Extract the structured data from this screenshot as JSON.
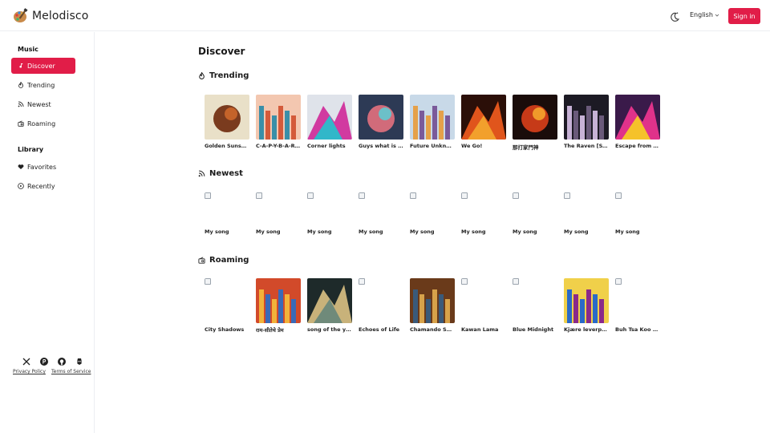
{
  "app": {
    "name": "Melodisco"
  },
  "header": {
    "language": "English",
    "sign_in": "Sign in"
  },
  "sidebar": {
    "music_label": "Music",
    "music_items": [
      {
        "label": "Discover",
        "icon": "music-note-icon",
        "active": true
      },
      {
        "label": "Trending",
        "icon": "flame-icon"
      },
      {
        "label": "Newest",
        "icon": "rss-icon"
      },
      {
        "label": "Roaming",
        "icon": "radio-icon"
      }
    ],
    "library_label": "Library",
    "library_items": [
      {
        "label": "Favorites",
        "icon": "heart-icon"
      },
      {
        "label": "Recently",
        "icon": "play-circle-icon"
      }
    ],
    "socials": [
      "x-icon",
      "product-hunt-icon",
      "github-icon",
      "discord-icon"
    ],
    "privacy": "Privacy Policy",
    "terms": "Terms of Service"
  },
  "main": {
    "title": "Discover",
    "trending": {
      "title": "Trending",
      "songs": [
        {
          "title": "Golden Sunshi...",
          "colors": [
            "#e9e0c8",
            "#7a3b1e",
            "#c4632a"
          ]
        },
        {
          "title": "C-A-P-Y-B-A-R-A",
          "colors": [
            "#f3c7b0",
            "#d45a3a",
            "#3a8fa8"
          ]
        },
        {
          "title": "Corner lights",
          "colors": [
            "#dfe3ea",
            "#d13aa0",
            "#31b7c9"
          ]
        },
        {
          "title": "Guys what is ...",
          "colors": [
            "#2d3a55",
            "#d16b7a",
            "#6cc0c8"
          ]
        },
        {
          "title": "Future Unknown",
          "colors": [
            "#c8d9e8",
            "#7a5a9a",
            "#e5a14a"
          ]
        },
        {
          "title": "We Go!",
          "colors": [
            "#2b0f08",
            "#e0551c",
            "#f2a02c"
          ]
        },
        {
          "title": "那打家門神",
          "colors": [
            "#1a0c0a",
            "#c63a18",
            "#f09a2a"
          ]
        },
        {
          "title": "The Raven [SS...",
          "colors": [
            "#1c1a24",
            "#6a5a7a",
            "#c7b2d6"
          ]
        },
        {
          "title": "Escape from 9...",
          "colors": [
            "#3a1a4a",
            "#e0328a",
            "#f5c22a"
          ]
        }
      ]
    },
    "newest": {
      "title": "Newest",
      "songs": [
        {
          "title": "My song"
        },
        {
          "title": "My song"
        },
        {
          "title": "My song"
        },
        {
          "title": "My song"
        },
        {
          "title": "My song"
        },
        {
          "title": "My song"
        },
        {
          "title": "My song"
        },
        {
          "title": "My song"
        },
        {
          "title": "My song"
        }
      ]
    },
    "roaming": {
      "title": "Roaming",
      "songs": [
        {
          "title": "City Shadows",
          "image": false
        },
        {
          "title": "राम-सीतेचे प्रेम",
          "image": true,
          "colors": [
            "#d24a2a",
            "#3a6ab8",
            "#f2b23a"
          ]
        },
        {
          "title": "song of the year",
          "image": true,
          "colors": [
            "#1e2a2a",
            "#c8b27a",
            "#6f8a7a"
          ]
        },
        {
          "title": "Echoes of Life",
          "image": false
        },
        {
          "title": "Chamando Sa...",
          "image": true,
          "colors": [
            "#6a3a1a",
            "#d7a24a",
            "#3a5a7a"
          ]
        },
        {
          "title": "Kawan Lama",
          "image": false
        },
        {
          "title": "Blue Midnight",
          "image": false
        },
        {
          "title": "Kjære leverpo...",
          "image": true,
          "colors": [
            "#f0d04a",
            "#8a2a8a",
            "#2a6ac8"
          ]
        },
        {
          "title": "Buh Tsa Koo P...",
          "image": false
        }
      ]
    }
  }
}
